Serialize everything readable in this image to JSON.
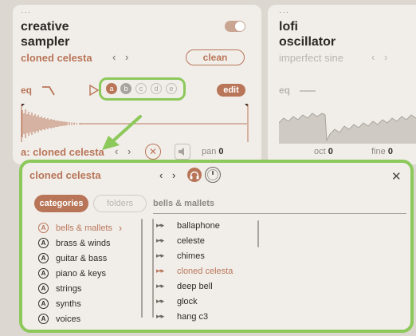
{
  "left_card": {
    "title_line1": "creative",
    "title_line2": "sampler",
    "preset": "cloned celesta",
    "nav": "‹ ›",
    "clean_label": "clean",
    "eq_label": "eq",
    "voices": [
      "a",
      "b",
      "c",
      "d",
      "e"
    ],
    "edit_label": "edit",
    "sample_label": "a: cloned celesta",
    "pan_label": "pan",
    "pan_value": "0"
  },
  "right_card": {
    "title_line1": "lofi",
    "title_line2": "oscillator",
    "preset": "imperfect sine",
    "nav": "‹ ›",
    "eq_label": "eq",
    "oct_label": "oct",
    "oct_value": "0",
    "fine_label": "fine",
    "fine_value": "0"
  },
  "popup": {
    "title": "cloned celesta",
    "nav": "‹ ›",
    "close": "✕",
    "tab_categories": "categories",
    "tab_folders": "folders",
    "breadcrumb": "bells & mallets",
    "categories": [
      "bells & mallets",
      "brass & winds",
      "guitar & bass",
      "piano & keys",
      "strings",
      "synths",
      "voices"
    ],
    "active_category_arrow": "›",
    "patches": [
      "ballaphone",
      "celeste",
      "chimes",
      "cloned celesta",
      "deep bell",
      "glock",
      "hang c3"
    ]
  },
  "colors": {
    "accent": "#b97558",
    "highlight": "#8cc85a",
    "panel": "#f1eeea",
    "background": "#dcd8d1"
  }
}
